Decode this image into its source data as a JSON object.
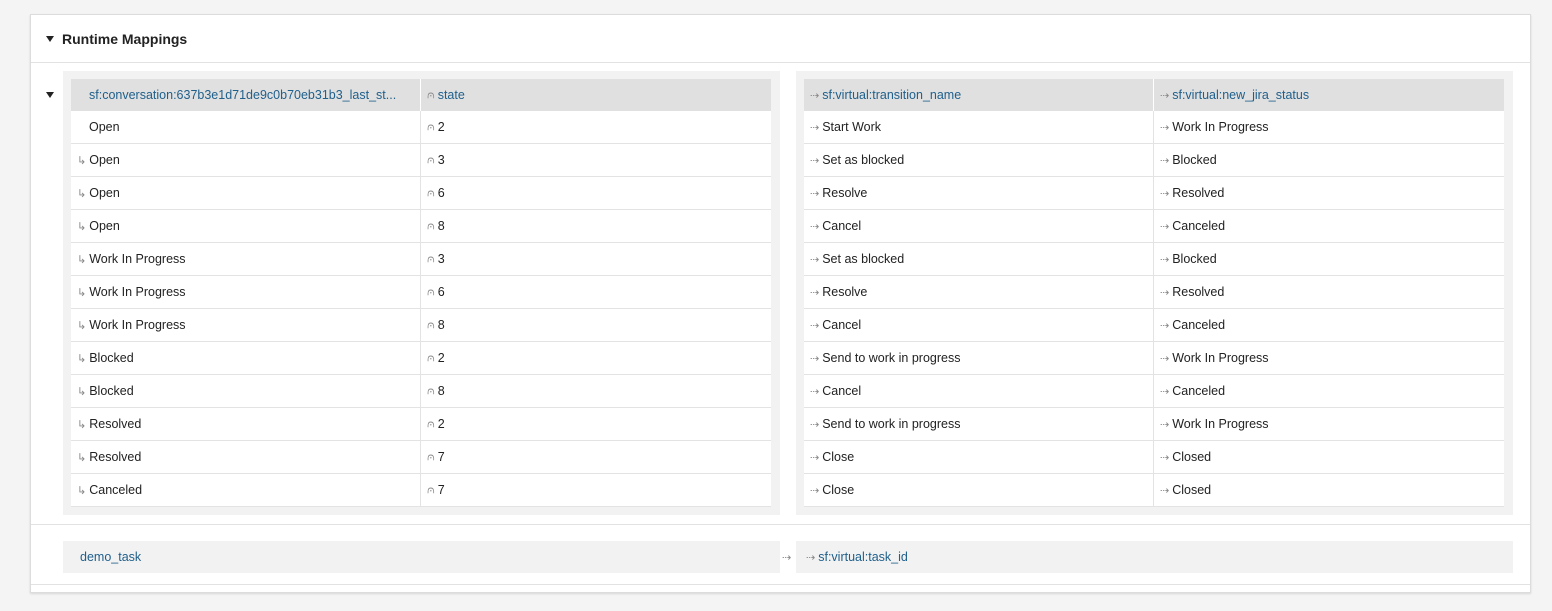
{
  "panel": {
    "title": "Runtime Mappings"
  },
  "glyphs": {
    "state": "⩀",
    "arrow": "⇢",
    "child": "↳"
  },
  "left_table": {
    "headers": [
      "sf:conversation:637b3e1d71de9c0b70eb31b3_last_st...",
      "state"
    ],
    "rows": [
      {
        "label": "Open",
        "value": "2",
        "child": false
      },
      {
        "label": "Open",
        "value": "3",
        "child": true
      },
      {
        "label": "Open",
        "value": "6",
        "child": true
      },
      {
        "label": "Open",
        "value": "8",
        "child": true
      },
      {
        "label": "Work In Progress",
        "value": "3",
        "child": true
      },
      {
        "label": "Work In Progress",
        "value": "6",
        "child": true
      },
      {
        "label": "Work In Progress",
        "value": "8",
        "child": true
      },
      {
        "label": "Blocked",
        "value": "2",
        "child": true
      },
      {
        "label": "Blocked",
        "value": "8",
        "child": true
      },
      {
        "label": "Resolved",
        "value": "2",
        "child": true
      },
      {
        "label": "Resolved",
        "value": "7",
        "child": true
      },
      {
        "label": "Canceled",
        "value": "7",
        "child": true
      }
    ]
  },
  "right_table": {
    "headers": [
      "sf:virtual:transition_name",
      "sf:virtual:new_jira_status"
    ],
    "rows": [
      {
        "transition": "Start Work",
        "status": "Work In Progress"
      },
      {
        "transition": "Set as blocked",
        "status": "Blocked"
      },
      {
        "transition": "Resolve",
        "status": "Resolved"
      },
      {
        "transition": "Cancel",
        "status": "Canceled"
      },
      {
        "transition": "Set as blocked",
        "status": "Blocked"
      },
      {
        "transition": "Resolve",
        "status": "Resolved"
      },
      {
        "transition": "Cancel",
        "status": "Canceled"
      },
      {
        "transition": "Send to work in progress",
        "status": "Work In Progress"
      },
      {
        "transition": "Cancel",
        "status": "Canceled"
      },
      {
        "transition": "Send to work in progress",
        "status": "Work In Progress"
      },
      {
        "transition": "Close",
        "status": "Closed"
      },
      {
        "transition": "Close",
        "status": "Closed"
      }
    ]
  },
  "footer": {
    "source": "demo_task",
    "target": "sf:virtual:task_id"
  }
}
